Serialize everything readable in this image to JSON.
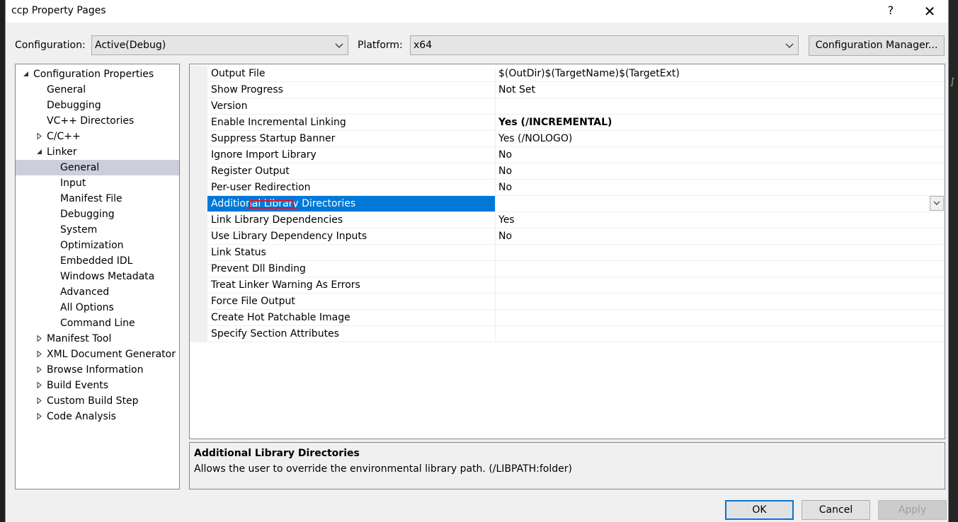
{
  "window": {
    "title": "ccp Property Pages",
    "help_glyph": "?",
    "close_glyph": "✕"
  },
  "config_bar": {
    "configuration_label": "Configuration:",
    "configuration_value": "Active(Debug)",
    "platform_label": "Platform:",
    "platform_value": "x64",
    "manager_button": "Configuration Manager..."
  },
  "tree": {
    "items": [
      {
        "label": "Configuration Properties",
        "level": 0,
        "expander": "expanded"
      },
      {
        "label": "General",
        "level": 1,
        "expander": "none"
      },
      {
        "label": "Debugging",
        "level": 1,
        "expander": "none"
      },
      {
        "label": "VC++ Directories",
        "level": 1,
        "expander": "none"
      },
      {
        "label": "C/C++",
        "level": 1,
        "expander": "collapsed"
      },
      {
        "label": "Linker",
        "level": 1,
        "expander": "expanded"
      },
      {
        "label": "General",
        "level": 2,
        "expander": "none",
        "selected": true
      },
      {
        "label": "Input",
        "level": 2,
        "expander": "none"
      },
      {
        "label": "Manifest File",
        "level": 2,
        "expander": "none"
      },
      {
        "label": "Debugging",
        "level": 2,
        "expander": "none"
      },
      {
        "label": "System",
        "level": 2,
        "expander": "none"
      },
      {
        "label": "Optimization",
        "level": 2,
        "expander": "none"
      },
      {
        "label": "Embedded IDL",
        "level": 2,
        "expander": "none"
      },
      {
        "label": "Windows Metadata",
        "level": 2,
        "expander": "none"
      },
      {
        "label": "Advanced",
        "level": 2,
        "expander": "none"
      },
      {
        "label": "All Options",
        "level": 2,
        "expander": "none"
      },
      {
        "label": "Command Line",
        "level": 2,
        "expander": "none"
      },
      {
        "label": "Manifest Tool",
        "level": 1,
        "expander": "collapsed"
      },
      {
        "label": "XML Document Generator",
        "level": 1,
        "expander": "collapsed"
      },
      {
        "label": "Browse Information",
        "level": 1,
        "expander": "collapsed"
      },
      {
        "label": "Build Events",
        "level": 1,
        "expander": "collapsed"
      },
      {
        "label": "Custom Build Step",
        "level": 1,
        "expander": "collapsed"
      },
      {
        "label": "Code Analysis",
        "level": 1,
        "expander": "collapsed"
      }
    ]
  },
  "properties": [
    {
      "name": "Output File",
      "value": "$(OutDir)$(TargetName)$(TargetExt)"
    },
    {
      "name": "Show Progress",
      "value": "Not Set"
    },
    {
      "name": "Version",
      "value": ""
    },
    {
      "name": "Enable Incremental Linking",
      "value": "Yes (/INCREMENTAL)",
      "bold": true
    },
    {
      "name": "Suppress Startup Banner",
      "value": "Yes (/NOLOGO)"
    },
    {
      "name": "Ignore Import Library",
      "value": "No"
    },
    {
      "name": "Register Output",
      "value": "No"
    },
    {
      "name": "Per-user Redirection",
      "value": "No"
    },
    {
      "name": "Additional Library Directories",
      "value": "",
      "selected": true
    },
    {
      "name": "Link Library Dependencies",
      "value": "Yes"
    },
    {
      "name": "Use Library Dependency Inputs",
      "value": "No"
    },
    {
      "name": "Link Status",
      "value": ""
    },
    {
      "name": "Prevent Dll Binding",
      "value": ""
    },
    {
      "name": "Treat Linker Warning As Errors",
      "value": ""
    },
    {
      "name": "Force File Output",
      "value": ""
    },
    {
      "name": "Create Hot Patchable Image",
      "value": ""
    },
    {
      "name": "Specify Section Attributes",
      "value": ""
    }
  ],
  "description": {
    "title": "Additional Library Directories",
    "text": "Allows the user to override the environmental library path. (/LIBPATH:folder)"
  },
  "buttons": {
    "ok": "OK",
    "cancel": "Cancel",
    "apply": "Apply"
  },
  "colors": {
    "selection_blue": "#0078d7",
    "tree_selection": "#cccedb",
    "annotation_red": "#e81123"
  }
}
